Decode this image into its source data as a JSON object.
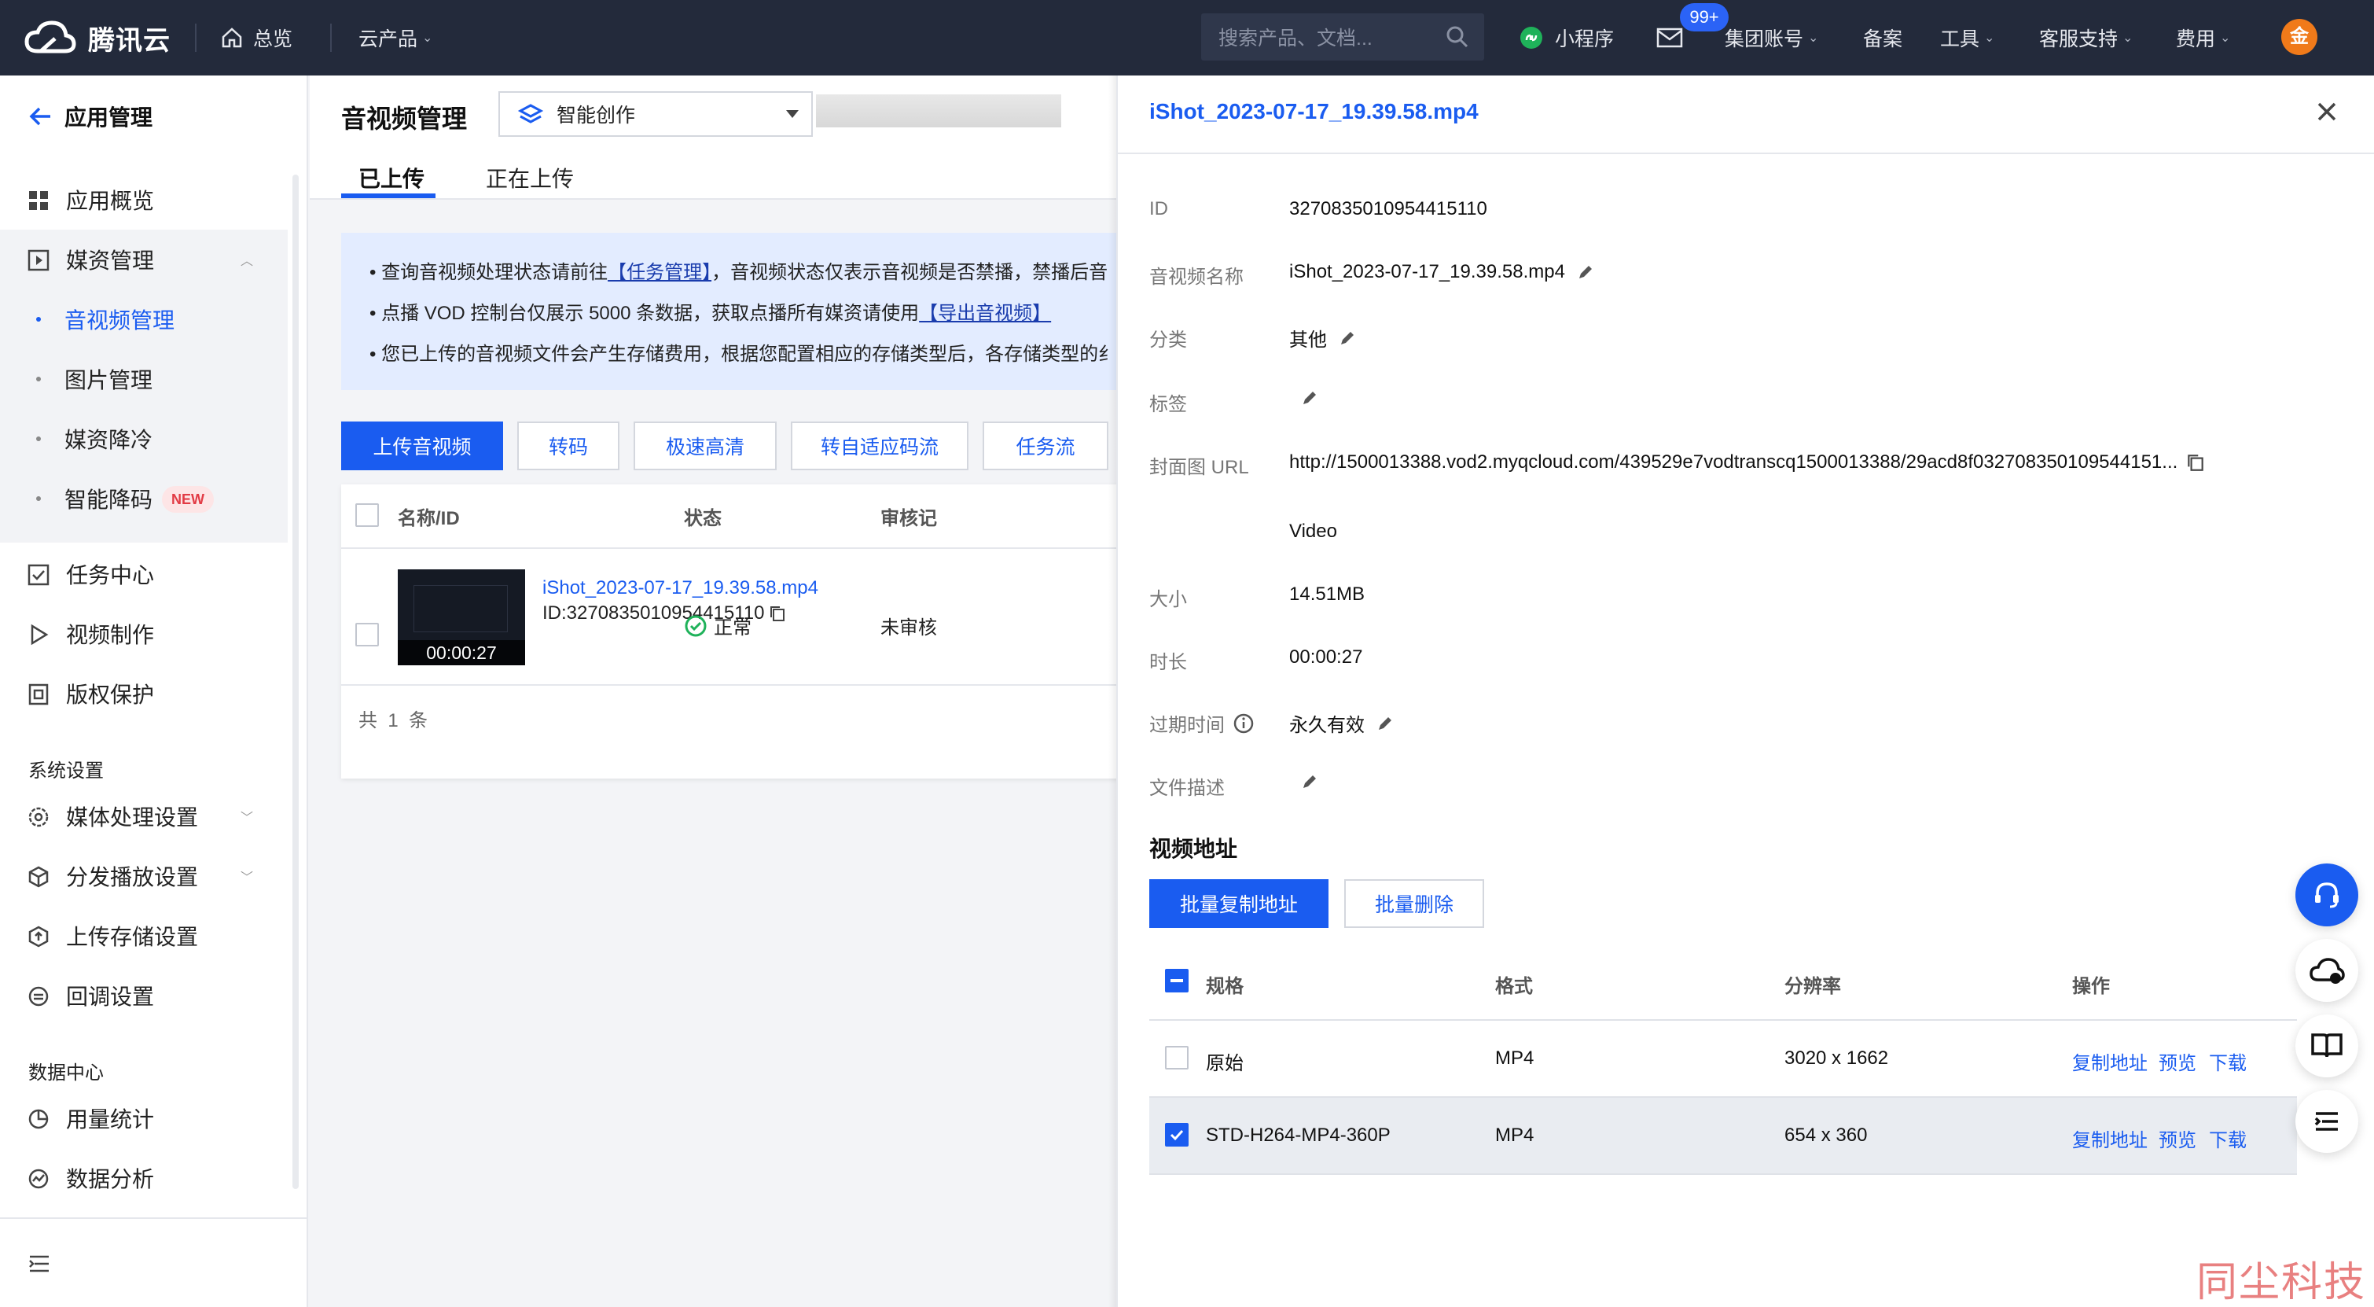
{
  "topbar": {
    "logo_text": "腾讯云",
    "nav_overview": "总览",
    "nav_products": "云产品",
    "search_placeholder": "搜索产品、文档...",
    "mini_program": "小程序",
    "message_badge": "99+",
    "group_account": "集团账号",
    "record": "备案",
    "tools": "工具",
    "support": "客服支持",
    "fees": "费用",
    "avatar": "金"
  },
  "sidebar": {
    "back_label": "应用管理",
    "items": [
      {
        "label": "应用概览",
        "icon": "grid-icon"
      },
      {
        "label": "媒资管理",
        "icon": "media-icon"
      },
      {
        "label": "音视频管理"
      },
      {
        "label": "图片管理"
      },
      {
        "label": "媒资降冷"
      },
      {
        "label": "智能降码",
        "badge": "NEW"
      },
      {
        "label": "任务中心",
        "icon": "task-icon"
      },
      {
        "label": "视频制作",
        "icon": "play-icon"
      },
      {
        "label": "版权保护",
        "icon": "copyright-icon"
      }
    ],
    "section_system": "系统设置",
    "system_items": [
      {
        "label": "媒体处理设置"
      },
      {
        "label": "分发播放设置"
      },
      {
        "label": "上传存储设置"
      },
      {
        "label": "回调设置"
      }
    ],
    "section_data": "数据中心",
    "data_items": [
      {
        "label": "用量统计"
      },
      {
        "label": "数据分析"
      }
    ]
  },
  "main": {
    "title": "音视频管理",
    "app_select": "智能创作",
    "tabs": [
      "已上传",
      "正在上传"
    ],
    "notice": {
      "line1_a": "查询音视频处理状态请前往",
      "line1_link": "【任务管理】",
      "line1_b": "，音视频状态仅表示音视频是否禁播，禁播后音",
      "line2_a": "点播 VOD 控制台仅展示 5000 条数据，获取点播所有媒资请使用",
      "line2_link": "【导出音视频】",
      "line3": "您已上传的音视频文件会产生存储费用，根据您配置相应的存储类型后，各存储类型的纟"
    },
    "buttons": [
      "上传音视频",
      "转码",
      "极速高清",
      "转自适应码流",
      "任务流"
    ],
    "table": {
      "headers": [
        "名称/ID",
        "状态",
        "审核记"
      ],
      "rows": [
        {
          "name": "iShot_2023-07-17_19.39.58.mp4",
          "id": "ID:3270835010954415110",
          "duration": "00:00:27",
          "status": "正常",
          "audit": "未审核"
        }
      ],
      "total_prefix": "共",
      "total_count": "1",
      "total_suffix": "条"
    }
  },
  "drawer": {
    "title": "iShot_2023-07-17_19.39.58.mp4",
    "fields": {
      "id_label": "ID",
      "id_value": "3270835010954415110",
      "name_label": "音视频名称",
      "name_value": "iShot_2023-07-17_19.39.58.mp4",
      "category_label": "分类",
      "category_value": "其他",
      "tag_label": "标签",
      "cover_label": "封面图 URL",
      "cover_value": "http://1500013388.vod2.myqcloud.com/439529e7vodtranscq1500013388/29acd8f032708350109544151...",
      "type_value": "Video",
      "size_label": "大小",
      "size_value": "14.51MB",
      "duration_label": "时长",
      "duration_value": "00:00:27",
      "expire_label": "过期时间",
      "expire_value": "永久有效",
      "desc_label": "文件描述"
    },
    "section_title": "视频地址",
    "btn_copy_all": "批量复制地址",
    "btn_delete_all": "批量删除",
    "table": {
      "headers": [
        "规格",
        "格式",
        "分辨率",
        "操作"
      ],
      "rows": [
        {
          "spec": "原始",
          "format": "MP4",
          "resolution": "3020 x 1662",
          "checked": false
        },
        {
          "spec": "STD-H264-MP4-360P",
          "format": "MP4",
          "resolution": "654 x 360",
          "checked": true
        }
      ],
      "actions": [
        "复制地址",
        "预览",
        "下载"
      ]
    }
  },
  "watermark": "同尘科技"
}
